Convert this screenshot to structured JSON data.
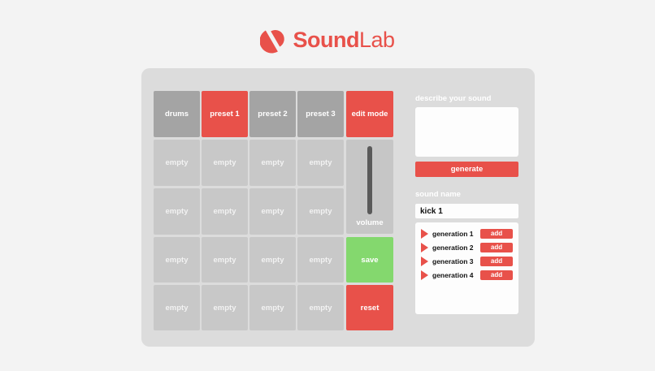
{
  "app": {
    "name_bold": "Sound",
    "name_light": "Lab",
    "accent": "#e8514a",
    "save_color": "#84d86e"
  },
  "grid": {
    "header": [
      "drums",
      "preset 1",
      "preset 2",
      "preset 3",
      "edit mode"
    ],
    "pad_label": "empty",
    "rows": [
      [
        "empty",
        "empty",
        "empty",
        "empty"
      ],
      [
        "empty",
        "empty",
        "empty",
        "empty"
      ],
      [
        "empty",
        "empty",
        "empty",
        "empty"
      ],
      [
        "empty",
        "empty",
        "empty",
        "empty"
      ]
    ],
    "volume_label": "volume",
    "save_label": "save",
    "reset_label": "reset"
  },
  "generator": {
    "describe_label": "describe your sound",
    "describe_value": "",
    "generate_label": "generate",
    "sound_name_label": "sound name",
    "sound_name_value": "kick 1",
    "generations": [
      {
        "name": "generation 1",
        "action": "add"
      },
      {
        "name": "generation 2",
        "action": "add"
      },
      {
        "name": "generation 3",
        "action": "add"
      },
      {
        "name": "generation 4",
        "action": "add"
      }
    ]
  }
}
